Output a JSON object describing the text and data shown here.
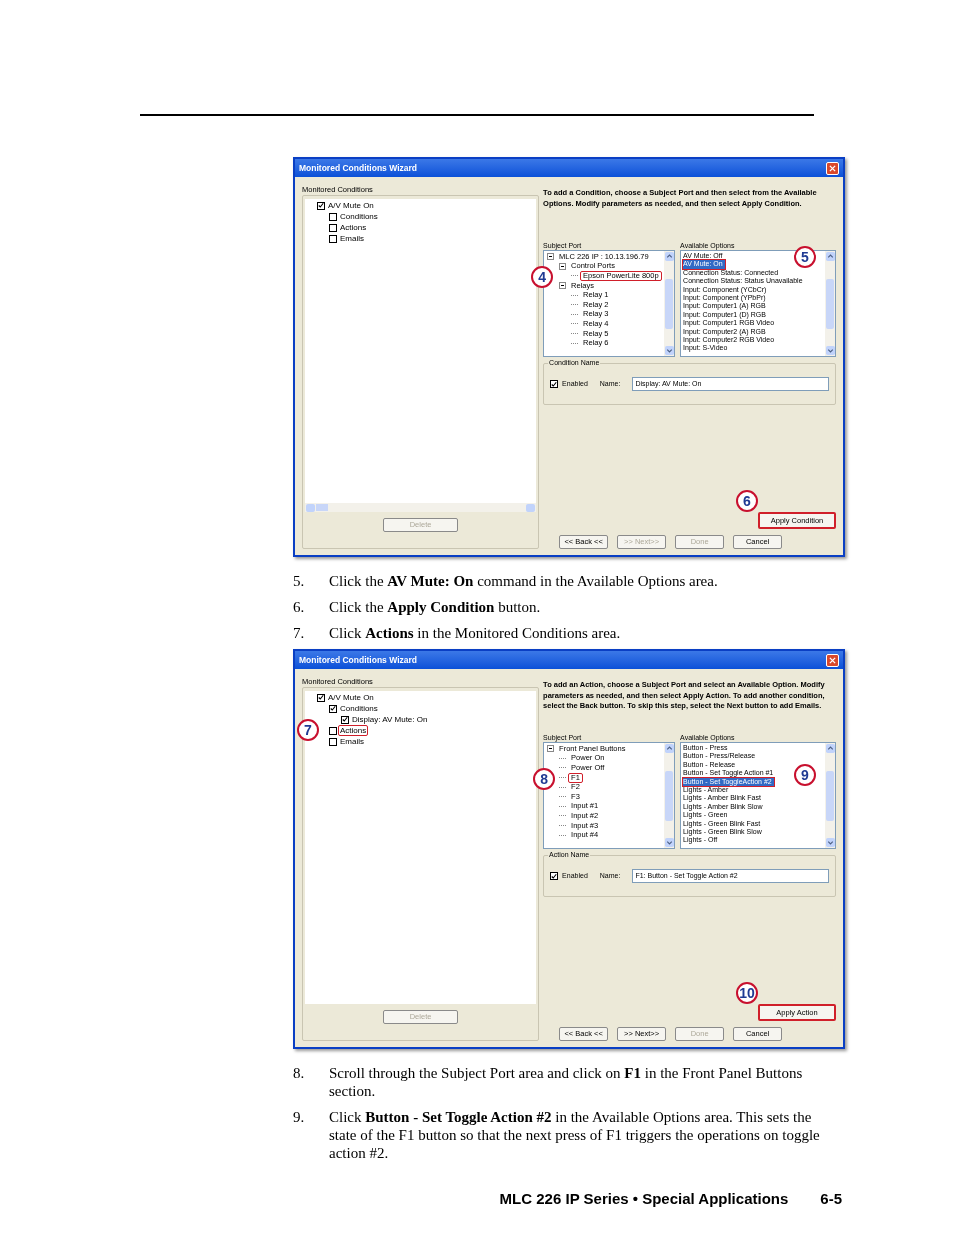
{
  "sections": [
    {
      "kind": "window",
      "title": "Monitored Conditions Wizard",
      "tree_label": "Monitored Conditions",
      "horizontal_scrollbar": true,
      "tree": [
        {
          "label": "A/V Mute On",
          "checked": true,
          "highlighted": false,
          "children": [
            {
              "label": "Conditions",
              "checked": false,
              "highlighted": false
            },
            {
              "label": "Actions",
              "checked": false,
              "highlighted": false
            },
            {
              "label": "Emails",
              "checked": false,
              "highlighted": false
            }
          ]
        }
      ],
      "delete_button": {
        "label": "Delete",
        "disabled": true
      },
      "instructions": "To add a Condition, choose a Subject Port and then select from the Available Options. Modify parameters as needed, and then select Apply Condition.",
      "subject_port": {
        "label": "Subject Port",
        "tree": [
          {
            "label": "MLC 226 IP : 10.13.196.79",
            "highlighted": false,
            "children": [
              {
                "label": "Control Ports",
                "highlighted": false,
                "children": [
                  {
                    "label": "Epson PowerLite 800p",
                    "highlighted": true,
                    "callout": "4"
                  }
                ]
              },
              {
                "label": "Relays",
                "highlighted": false,
                "children": [
                  {
                    "label": "Relay 1",
                    "highlighted": false
                  },
                  {
                    "label": "Relay 2",
                    "highlighted": false
                  },
                  {
                    "label": "Relay 3",
                    "highlighted": false
                  },
                  {
                    "label": "Relay 4",
                    "highlighted": false
                  },
                  {
                    "label": "Relay 5",
                    "highlighted": false
                  },
                  {
                    "label": "Relay 6",
                    "highlighted": false
                  }
                ]
              }
            ]
          }
        ]
      },
      "available_options": {
        "label": "Available Options",
        "items": [
          {
            "label": "AV Mute: Off",
            "selected": false
          },
          {
            "label": "AV Mute: On",
            "selected": true,
            "callout": "5"
          },
          {
            "label": "Connection Status: Connected",
            "selected": false
          },
          {
            "label": "Connection Status: Status Unavailable",
            "selected": false
          },
          {
            "label": "Input: Component (YCbCr)",
            "selected": false
          },
          {
            "label": "Input: Component (YPbPr)",
            "selected": false
          },
          {
            "label": "Input: Computer1 (A) RGB",
            "selected": false
          },
          {
            "label": "Input: Computer1 (D) RGB",
            "selected": false
          },
          {
            "label": "Input: Computer1 RGB Video",
            "selected": false
          },
          {
            "label": "Input: Computer2 (A) RGB",
            "selected": false
          },
          {
            "label": "Input: Computer2 RGB Video",
            "selected": false
          },
          {
            "label": "Input: S-Video",
            "selected": false
          }
        ]
      },
      "name_group": {
        "legend": "Condition Name",
        "enabled_label": "Enabled",
        "enabled": true,
        "name_label": "Name:",
        "name_value": "Display: AV Mute: On"
      },
      "apply_button": {
        "label": "Apply Condition",
        "callout": "6"
      },
      "nav_buttons": [
        {
          "label": "<< Back <<",
          "disabled": false
        },
        {
          "label": ">> Next>>",
          "disabled": true
        },
        {
          "label": "Done",
          "disabled": true
        },
        {
          "label": "Cancel",
          "disabled": false
        }
      ]
    },
    {
      "kind": "steps",
      "items": [
        {
          "number": "5.",
          "text": "Click the **AV Mute: On** command in the Available Options area."
        },
        {
          "number": "6.",
          "text": "Click the **Apply Condition** button."
        },
        {
          "number": "7.",
          "text": "Click **Actions** in the Monitored Conditions area."
        }
      ]
    },
    {
      "kind": "window",
      "title": "Monitored Conditions Wizard",
      "tree_label": "Monitored Conditions",
      "horizontal_scrollbar": false,
      "tree": [
        {
          "label": "A/V Mute On",
          "checked": true,
          "highlighted": false,
          "children": [
            {
              "label": "Conditions",
              "checked": true,
              "highlighted": false,
              "children": [
                {
                  "label": "Display: AV Mute: On",
                  "checked": true,
                  "highlighted": false
                }
              ]
            },
            {
              "label": "Actions",
              "checked": false,
              "highlighted": true,
              "callout": "7"
            },
            {
              "label": "Emails",
              "checked": false,
              "highlighted": false
            }
          ]
        }
      ],
      "delete_button": {
        "label": "Delete",
        "disabled": true
      },
      "instructions": "To add an Action, choose a Subject Port and select an Available Option. Modify parameters as needed, and then select Apply Action. To add another condition, select the Back button. To skip this step, select the Next button to add Emails.",
      "subject_port": {
        "label": "Subject Port",
        "tree": [
          {
            "label": "Front Panel Buttons",
            "highlighted": false,
            "children": [
              {
                "label": "Power On",
                "highlighted": false
              },
              {
                "label": "Power Off",
                "highlighted": false
              },
              {
                "label": "F1",
                "highlighted": true,
                "callout": "8"
              },
              {
                "label": "F2",
                "highlighted": false
              },
              {
                "label": "F3",
                "highlighted": false
              },
              {
                "label": "Input #1",
                "highlighted": false
              },
              {
                "label": "Input #2",
                "highlighted": false
              },
              {
                "label": "Input #3",
                "highlighted": false
              },
              {
                "label": "Input #4",
                "highlighted": false
              }
            ]
          }
        ]
      },
      "available_options": {
        "label": "Available Options",
        "items": [
          {
            "label": "Button - Press",
            "selected": false
          },
          {
            "label": "Button - Press/Release",
            "selected": false
          },
          {
            "label": "Button - Release",
            "selected": false
          },
          {
            "label": "Button - Set Toggle Action #1",
            "selected": false
          },
          {
            "label": "Button - Set ToggleAction #2",
            "selected": true,
            "callout": "9"
          },
          {
            "label": "Lights - Amber",
            "selected": false
          },
          {
            "label": "Lights - Amber Blink Fast",
            "selected": false
          },
          {
            "label": "Lights - Amber Blink Slow",
            "selected": false
          },
          {
            "label": "Lights - Green",
            "selected": false
          },
          {
            "label": "Lights - Green Blink Fast",
            "selected": false
          },
          {
            "label": "Lights - Green Blink Slow",
            "selected": false
          },
          {
            "label": "Lights - Off",
            "selected": false
          }
        ]
      },
      "name_group": {
        "legend": "Action Name",
        "enabled_label": "Enabled",
        "enabled": true,
        "name_label": "Name:",
        "name_value": "F1: Button - Set Toggle Action #2"
      },
      "apply_button": {
        "label": "Apply Action",
        "callout": "10"
      },
      "nav_buttons": [
        {
          "label": "<< Back <<",
          "disabled": false
        },
        {
          "label": ">> Next>>",
          "disabled": false
        },
        {
          "label": "Done",
          "disabled": true
        },
        {
          "label": "Cancel",
          "disabled": false
        }
      ]
    },
    {
      "kind": "steps",
      "items": [
        {
          "number": "8.",
          "text": "Scroll through the Subject Port area and click on **F1** in the Front Panel Buttons section."
        },
        {
          "number": "9.",
          "text": "Click **Button - Set Toggle Action #2** in the Available Options area.  This sets the state of the F1 button so that the next press of F1 triggers the operations on toggle action #2."
        }
      ]
    }
  ],
  "footer": {
    "title": "MLC 226 IP Series • Special Applications",
    "page": "6-5"
  }
}
